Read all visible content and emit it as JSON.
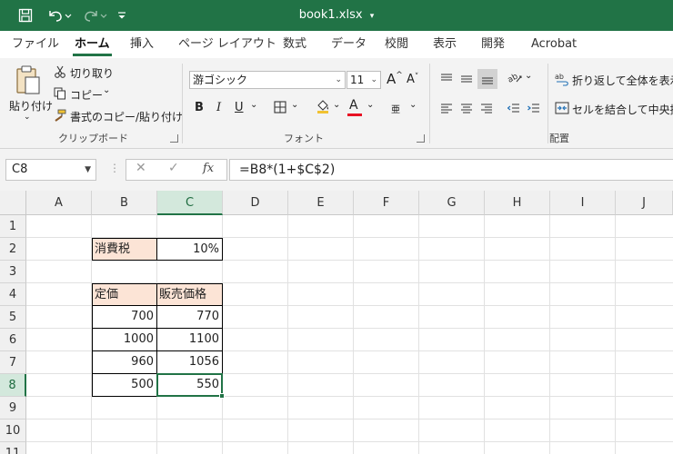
{
  "titlebar": {
    "filename": "book1.xlsx",
    "filename_caret": "▾",
    "icons": [
      "save-icon",
      "undo-icon",
      "redo-icon",
      "customize-qat-icon"
    ]
  },
  "tabs": [
    "ファイル",
    "ホーム",
    "挿入",
    "ページ レイアウト",
    "数式",
    "データ",
    "校閲",
    "表示",
    "開発",
    "Acrobat"
  ],
  "active_tab": "ホーム",
  "clipboard": {
    "paste": "貼り付け",
    "cut": "切り取り",
    "copy": "コピー",
    "format_painter": "書式のコピー/貼り付け",
    "label": "クリップボード"
  },
  "font": {
    "name": "游ゴシック",
    "size": "11",
    "grow": "A",
    "shrink": "A",
    "bold": "B",
    "italic": "I",
    "underline": "U",
    "font_color": "A",
    "phonetic": "亜",
    "label": "フォント"
  },
  "alignment": {
    "wrap_text": "折り返して全体を表示する",
    "merge_center": "セルを結合して中央揃え",
    "label": "配置"
  },
  "formula_bar": {
    "name_box": "C8",
    "fx": "fx",
    "formula": "=B8*(1+$C$2)"
  },
  "columns": [
    "A",
    "B",
    "C",
    "D",
    "E",
    "F",
    "G",
    "H",
    "I",
    "J"
  ],
  "rows": [
    "1",
    "2",
    "3",
    "4",
    "5",
    "6",
    "7",
    "8",
    "9",
    "10",
    "11"
  ],
  "cells": {
    "B2": "消費税",
    "C2": "10%",
    "B4": "定価",
    "C4": "販売価格",
    "B5": "700",
    "C5": "770",
    "B6": "1000",
    "C6": "1100",
    "B7": "960",
    "C7": "1056",
    "B8": "500",
    "C8": "550"
  },
  "selected_cell": "C8",
  "colors": {
    "accent": "#217346",
    "header_fill": "#fce4d6",
    "font_color_bar": "#e81123"
  }
}
